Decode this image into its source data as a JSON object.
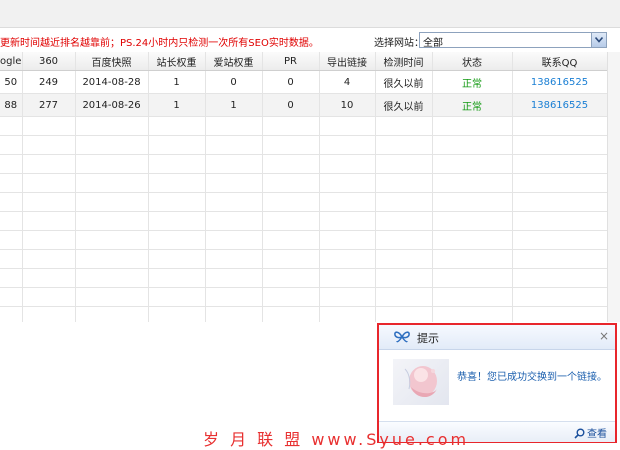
{
  "notice": "更新时间越近排名越靠前；PS.24小时内只检测一次所有SEO实时数据。",
  "site_filter": {
    "label": "选择网站：",
    "selected": "全部"
  },
  "table": {
    "columns": [
      "ogle",
      "360",
      "百度快照",
      "站长权重",
      "爱站权重",
      "PR",
      "导出链接",
      "检测时间",
      "状态",
      "联系QQ"
    ],
    "rows": [
      [
        "50",
        "249",
        "2014-08-28",
        "1",
        "0",
        "0",
        "4",
        "很久以前",
        "正常",
        "138616525"
      ],
      [
        "88",
        "277",
        "2014-08-26",
        "1",
        "1",
        "0",
        "10",
        "很久以前",
        "正常",
        "138616525"
      ]
    ]
  },
  "popup": {
    "title": "提示",
    "close_glyph": "×",
    "message": "恭喜！您已成功交换到一个链接。",
    "view_label": "查看"
  },
  "watermark": "岁 月 联 盟  www.Syue.com",
  "colors": {
    "notice": "#e00000",
    "status_ok": "#139a13",
    "qq_link": "#1a7fd4",
    "popup_border": "#e8262c"
  },
  "icons": {
    "popup_logo": "butterfly-logo-icon",
    "view": "magnifier-icon",
    "select": "chevron-down-icon"
  }
}
